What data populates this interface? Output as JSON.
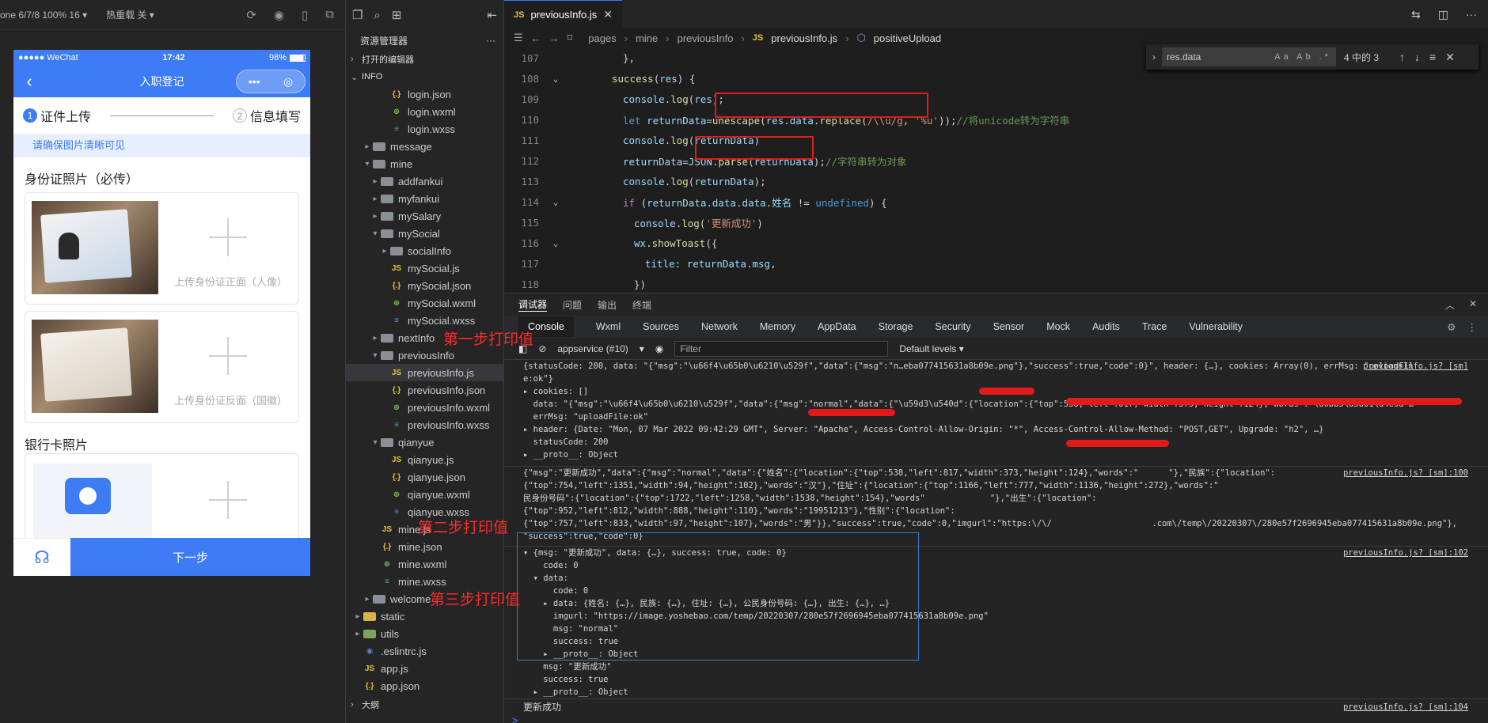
{
  "sim_toolbar": {
    "device": "one 6/7/8 100% 16 ▾",
    "hotreload": "热重载 关 ▾"
  },
  "phone": {
    "carrier": "●●●●● WeChat",
    "time": "17:42",
    "battery": "98%",
    "nav_title": "入职登记",
    "step1_num": "1",
    "step1": "证件上传",
    "step2_num": "2",
    "step2": "信息填写",
    "tip": "请确保图片清晰可见",
    "id_title": "身份证照片（必传）",
    "front_caption": "上传身份证正面（人像）",
    "back_caption": "上传身份证反面（国徽）",
    "bank_title": "银行卡照片",
    "next_button": "下一步"
  },
  "explorer": {
    "header": "资源管理器",
    "more": "···",
    "open_editors": "打开的编辑器",
    "project": "INFO",
    "items": [
      {
        "name": "login.json",
        "type": "json",
        "depth": 3
      },
      {
        "name": "login.wxml",
        "type": "wxml",
        "depth": 3
      },
      {
        "name": "login.wxss",
        "type": "wxss",
        "depth": 3
      },
      {
        "name": "message",
        "type": "folder",
        "depth": 1,
        "tw": "▸"
      },
      {
        "name": "mine",
        "type": "folder",
        "depth": 1,
        "tw": "▾"
      },
      {
        "name": "addfankui",
        "type": "folder",
        "depth": 2,
        "tw": "▸"
      },
      {
        "name": "myfankui",
        "type": "folder",
        "depth": 2,
        "tw": "▸"
      },
      {
        "name": "mySalary",
        "type": "folder",
        "depth": 2,
        "tw": "▸"
      },
      {
        "name": "mySocial",
        "type": "folder",
        "depth": 2,
        "tw": "▾"
      },
      {
        "name": "socialInfo",
        "type": "folder",
        "depth": 3,
        "tw": "▸"
      },
      {
        "name": "mySocial.js",
        "type": "js",
        "depth": 3
      },
      {
        "name": "mySocial.json",
        "type": "json",
        "depth": 3
      },
      {
        "name": "mySocial.wxml",
        "type": "wxml",
        "depth": 3
      },
      {
        "name": "mySocial.wxss",
        "type": "wxss",
        "depth": 3
      },
      {
        "name": "nextInfo",
        "type": "folder",
        "depth": 2,
        "tw": "▸"
      },
      {
        "name": "previousInfo",
        "type": "folder",
        "depth": 2,
        "tw": "▾"
      },
      {
        "name": "previousInfo.js",
        "type": "js",
        "depth": 3,
        "sel": true
      },
      {
        "name": "previousInfo.json",
        "type": "json",
        "depth": 3
      },
      {
        "name": "previousInfo.wxml",
        "type": "wxml",
        "depth": 3
      },
      {
        "name": "previousInfo.wxss",
        "type": "wxss",
        "depth": 3
      },
      {
        "name": "qianyue",
        "type": "folder",
        "depth": 2,
        "tw": "▾"
      },
      {
        "name": "qianyue.js",
        "type": "js",
        "depth": 3
      },
      {
        "name": "qianyue.json",
        "type": "json",
        "depth": 3
      },
      {
        "name": "qianyue.wxml",
        "type": "wxml",
        "depth": 3
      },
      {
        "name": "qianyue.wxss",
        "type": "wxss",
        "depth": 3
      },
      {
        "name": "mine.js",
        "type": "js",
        "depth": 2
      },
      {
        "name": "mine.json",
        "type": "json",
        "depth": 2
      },
      {
        "name": "mine.wxml",
        "type": "wxml",
        "depth": 2
      },
      {
        "name": "mine.wxss",
        "type": "wxss",
        "depth": 2
      },
      {
        "name": "welcome",
        "type": "folder",
        "depth": 1,
        "tw": "▸"
      },
      {
        "name": "static",
        "type": "folder-yellow",
        "depth": 0,
        "tw": "▸"
      },
      {
        "name": "utils",
        "type": "folder-green",
        "depth": 0,
        "tw": "▸"
      },
      {
        "name": ".eslintrc.js",
        "type": "dot",
        "depth": 0
      },
      {
        "name": "app.js",
        "type": "js",
        "depth": 0
      },
      {
        "name": "app.json",
        "type": "json",
        "depth": 0
      }
    ],
    "outline": "大纲"
  },
  "editor": {
    "tab": "previousInfo.js",
    "crumbs": [
      "pages",
      "mine",
      "previousInfo"
    ],
    "crumb_file": "previousInfo.js",
    "crumb_symbol": "positiveUpload",
    "find": {
      "query": "res.data",
      "count": "4 中的 3"
    },
    "lines": [
      {
        "n": "107",
        "fold": "",
        "indent": 10,
        "parts": [
          [
            "k-pl",
            "},"
          ]
        ]
      },
      {
        "n": "108",
        "fold": "⌄",
        "indent": 8,
        "parts": [
          [
            "k-fn",
            "success"
          ],
          [
            "k-pl",
            "("
          ],
          [
            "k-var",
            "res"
          ],
          [
            "k-pl",
            ") {"
          ]
        ]
      },
      {
        "n": "109",
        "fold": "",
        "indent": 10,
        "parts": [
          [
            "k-var",
            "console"
          ],
          [
            "k-pl",
            "."
          ],
          [
            "k-fn",
            "log"
          ],
          [
            "k-pl",
            "("
          ],
          [
            "k-var",
            "res"
          ],
          [
            "k-pl",
            ");"
          ]
        ]
      },
      {
        "n": "110",
        "fold": "",
        "indent": 10,
        "parts": [
          [
            "k-kw",
            "let "
          ],
          [
            "k-var",
            "returnData"
          ],
          [
            "k-pl",
            "="
          ],
          [
            "k-fn",
            "unescape"
          ],
          [
            "k-pl",
            "("
          ],
          [
            "k-var",
            "res"
          ],
          [
            "k-pl",
            "."
          ],
          [
            "k-var",
            "data"
          ],
          [
            "k-pl",
            "."
          ],
          [
            "k-fn",
            "replace"
          ],
          [
            "k-pl",
            "("
          ],
          [
            "k-str",
            "/\\\\u/g"
          ],
          [
            "k-pl",
            ", "
          ],
          [
            "k-str",
            "'%u'"
          ],
          [
            "k-pl",
            "));"
          ],
          [
            "k-cm",
            "//将unicode转为字符串"
          ]
        ]
      },
      {
        "n": "111",
        "fold": "",
        "indent": 10,
        "parts": [
          [
            "k-var",
            "console"
          ],
          [
            "k-pl",
            "."
          ],
          [
            "k-fn",
            "log"
          ],
          [
            "k-pl",
            "("
          ],
          [
            "k-var",
            "returnData"
          ],
          [
            "k-pl",
            ")"
          ]
        ]
      },
      {
        "n": "112",
        "fold": "",
        "indent": 10,
        "parts": [
          [
            "k-var",
            "returnData"
          ],
          [
            "k-pl",
            "="
          ],
          [
            "k-var",
            "JSON"
          ],
          [
            "k-pl",
            "."
          ],
          [
            "k-fn",
            "parse"
          ],
          [
            "k-pl",
            "("
          ],
          [
            "k-var",
            "returnData"
          ],
          [
            "k-pl",
            ");"
          ],
          [
            "k-cm",
            "//字符串转为对象"
          ]
        ]
      },
      {
        "n": "113",
        "fold": "",
        "indent": 10,
        "parts": [
          [
            "k-var",
            "console"
          ],
          [
            "k-pl",
            "."
          ],
          [
            "k-fn",
            "log"
          ],
          [
            "k-pl",
            "("
          ],
          [
            "k-var",
            "returnData"
          ],
          [
            "k-pl",
            ");"
          ]
        ]
      },
      {
        "n": "114",
        "fold": "⌄",
        "indent": 10,
        "parts": [
          [
            "k-ctl",
            "if "
          ],
          [
            "k-pl",
            "("
          ],
          [
            "k-var",
            "returnData"
          ],
          [
            "k-pl",
            "."
          ],
          [
            "k-var",
            "data"
          ],
          [
            "k-pl",
            "."
          ],
          [
            "k-var",
            "data"
          ],
          [
            "k-pl",
            "."
          ],
          [
            "k-var",
            "姓名"
          ],
          [
            "k-pl",
            " != "
          ],
          [
            "k-kw",
            "undefined"
          ],
          [
            "k-pl",
            ") {"
          ]
        ]
      },
      {
        "n": "115",
        "fold": "",
        "indent": 12,
        "parts": [
          [
            "k-var",
            "console"
          ],
          [
            "k-pl",
            "."
          ],
          [
            "k-fn",
            "log"
          ],
          [
            "k-pl",
            "("
          ],
          [
            "k-str",
            "'更新成功'"
          ],
          [
            "k-pl",
            ")"
          ]
        ]
      },
      {
        "n": "116",
        "fold": "⌄",
        "indent": 12,
        "parts": [
          [
            "k-var",
            "wx"
          ],
          [
            "k-pl",
            "."
          ],
          [
            "k-fn",
            "showToast"
          ],
          [
            "k-pl",
            "({"
          ]
        ]
      },
      {
        "n": "117",
        "fold": "",
        "indent": 14,
        "parts": [
          [
            "k-var",
            "title"
          ],
          [
            "k-pl",
            ": "
          ],
          [
            "k-var",
            "returnData"
          ],
          [
            "k-pl",
            "."
          ],
          [
            "k-var",
            "msg"
          ],
          [
            "k-pl",
            ","
          ]
        ]
      },
      {
        "n": "118",
        "fold": "",
        "indent": 12,
        "parts": [
          [
            "k-pl",
            "})"
          ]
        ]
      }
    ]
  },
  "debug": {
    "tabs": [
      "调试器",
      "问题",
      "输出",
      "终端"
    ],
    "console_tabs": [
      "Console",
      "Wxml",
      "Sources",
      "Network",
      "Memory",
      "AppData",
      "Storage",
      "Security",
      "Sensor",
      "Mock",
      "Audits",
      "Trace",
      "Vulnerability"
    ],
    "context": "appservice (#10)",
    "filter_placeholder": "Filter",
    "levels": "Default levels ▾",
    "log1_head": "{statusCode: 200, data: \"{\"msg\":\"\\u66f4\\u65b0\\u6210\\u529f\",\"data\":{\"msg\":\"n…eba077415631a8b09e.png\"},\"success\":true,\"code\":0}\", header: {…}, cookies: Array(0), errMsg: \"uploadFil",
    "log1_head2": "e:ok\"}",
    "log1_cookies": "▸ cookies: []",
    "log1_data": "  data: \"{\"msg\":\"\\u66f4\\u65b0\\u6210\\u529f\",\"data\":{\"msg\":\"normal\",\"data\":{\"\\u59d3\\u540d\":{\"location\":{\"top\":538,\"left\":817,\"width\":373,\"height\":124},\"words\":\"\\u6bb5\\u5a01\\u4e9a\"…",
    "log1_err": "  errMsg: \"uploadFile:ok\"",
    "log1_header": "▸ header: {Date: \"Mon, 07 Mar 2022 09:42:29 GMT\", Server: \"Apache\", Access-Control-Allow-Origin: \"*\", Access-Control-Allow-Method: \"POST,GET\", Upgrade: \"h2\", …}",
    "log1_status": "  statusCode: 200",
    "log1_proto": "▸ __proto__: Object",
    "log2_l1": "{\"msg\":\"更新成功\",\"data\":{\"msg\":\"normal\",\"data\":{\"姓名\":{\"location\":{\"top\":538,\"left\":817,\"width\":373,\"height\":124},\"words\":\"      \"},\"民族\":{\"location\":",
    "log2_l2": "{\"top\":754,\"left\":1351,\"width\":94,\"height\":102},\"words\":\"汉\"},\"住址\":{\"location\":{\"top\":1166,\"left\":777,\"width\":1136,\"height\":272},\"words\":\"",
    "log2_l3": "民身份号码\":{\"location\":{\"top\":1722,\"left\":1258,\"width\":1538,\"height\":154},\"words\"             \"},\"出生\":{\"location\":",
    "log2_l4": "{\"top\":952,\"left\":812,\"width\":888,\"height\":110},\"words\":\"19951213\"},\"性别\":{\"location\":",
    "log2_l5": "{\"top\":757,\"left\":833,\"width\":97,\"height\":107},\"words\":\"男\"}},\"success\":true,\"code\":0,\"imgurl\":\"https:\\/\\/                    .com\\/temp\\/20220307\\/280e57f2696945eba077415631a8b09e.png\"},",
    "log2_l6": "\"success\":true,\"code\":0}",
    "log2_src": "previousInfo.js? [sm]:100",
    "log1_src": "previousInfo.js? [sm]",
    "log3_head": "▾ {msg: \"更新成功\", data: {…}, success: true, code: 0}",
    "log3_code": "    code: 0",
    "log3_data": "  ▾ data:",
    "log3_code2": "      code: 0",
    "log3_inner": "    ▸ data: {姓名: {…}, 民族: {…}, 住址: {…}, 公民身份号码: {…}, 出生: {…}, …}",
    "log3_img": "      imgurl: \"https://image.yoshebao.com/temp/20220307/280e57f2696945eba077415631a8b09e.png\"",
    "log3_msg": "      msg: \"normal\"",
    "log3_succ": "      success: true",
    "log3_proto": "    ▸ __proto__: Object",
    "log3_msg2": "    msg: \"更新成功\"",
    "log3_succ2": "    success: true",
    "log3_proto2": "  ▸ __proto__: Object",
    "log3_src": "previousInfo.js? [sm]:102",
    "log4": "更新成功",
    "log4_src": "previousInfo.js? [sm]:104",
    "prompt": ">"
  },
  "annotations": {
    "step1": "第一步打印值",
    "step2": "第二步打印值",
    "step3": "第三步打印值"
  }
}
